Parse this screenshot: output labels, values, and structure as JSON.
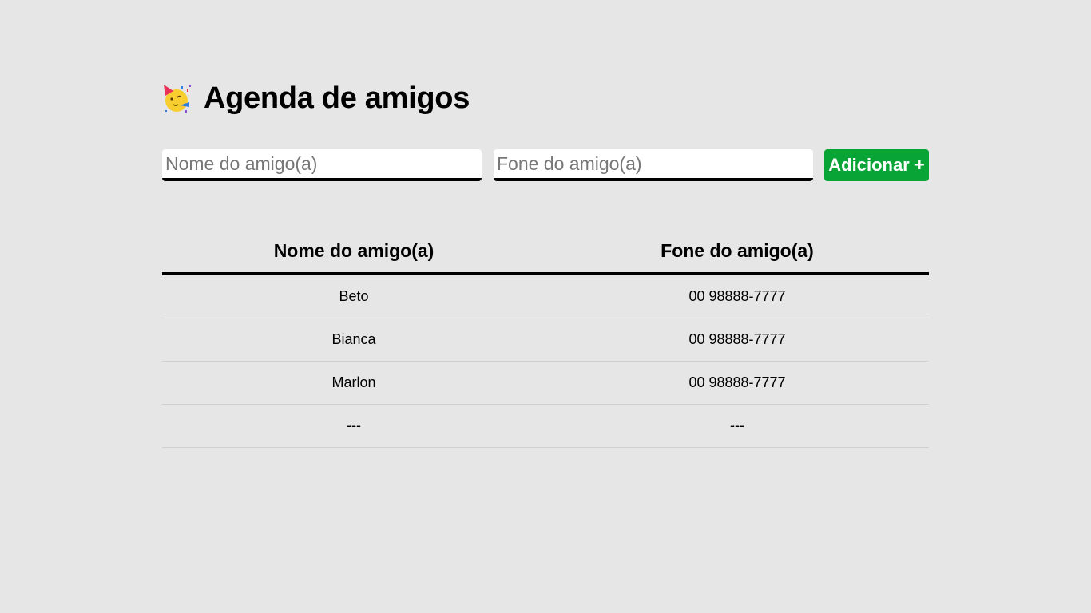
{
  "header": {
    "title": "Agenda de amigos",
    "icon": "party-face-icon"
  },
  "form": {
    "name_placeholder": "Nome do amigo(a)",
    "name_value": "",
    "phone_placeholder": "Fone do amigo(a)",
    "phone_value": "",
    "add_label": "Adicionar +"
  },
  "table": {
    "columns": [
      "Nome do amigo(a)",
      "Fone do amigo(a)"
    ],
    "rows": [
      {
        "name": "Beto",
        "phone": "00 98888-7777"
      },
      {
        "name": "Bianca",
        "phone": "00 98888-7777"
      },
      {
        "name": "Marlon",
        "phone": "00 98888-7777"
      },
      {
        "name": "---",
        "phone": "---"
      }
    ]
  },
  "colors": {
    "background": "#e6e6e6",
    "accent_button": "#08a436",
    "input_background": "#ffffff",
    "text": "#000000"
  }
}
